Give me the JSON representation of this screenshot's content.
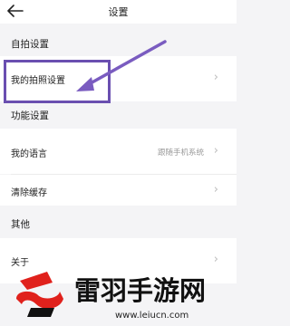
{
  "header": {
    "title": "设置"
  },
  "sections": {
    "selfie": {
      "title": "自拍设置",
      "items": [
        {
          "label": "我的拍照设置",
          "value": ""
        }
      ]
    },
    "function": {
      "title": "功能设置",
      "items": [
        {
          "label": "我的语言",
          "value": "跟随手机系统"
        },
        {
          "label": "清除缓存",
          "value": ""
        }
      ]
    },
    "other": {
      "title": "其他",
      "items": [
        {
          "label": "关于",
          "value": ""
        }
      ]
    }
  },
  "annotation": {
    "box_color": "#6a4fb0",
    "arrow_color": "#7a5cc0"
  },
  "watermark": {
    "title": "雷羽手游网",
    "url": "www.leiucn.com",
    "accent": "#e0211c"
  }
}
